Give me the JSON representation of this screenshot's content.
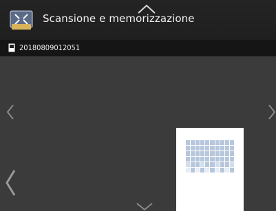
{
  "header": {
    "title": "Scansione e memorizzazione"
  },
  "document": {
    "name": "20180809012051"
  },
  "colors": {
    "header_bg": "#222222",
    "doc_bar_bg": "#151515",
    "body_bg": "#3b3b3b",
    "accent_icon": "#d8b35a"
  },
  "icons": {
    "app": "scan-store-icon",
    "scroll_up": "chevron-up-icon",
    "scroll_down": "chevron-down-icon",
    "prev": "chevron-left-icon",
    "next": "chevron-right-icon"
  }
}
